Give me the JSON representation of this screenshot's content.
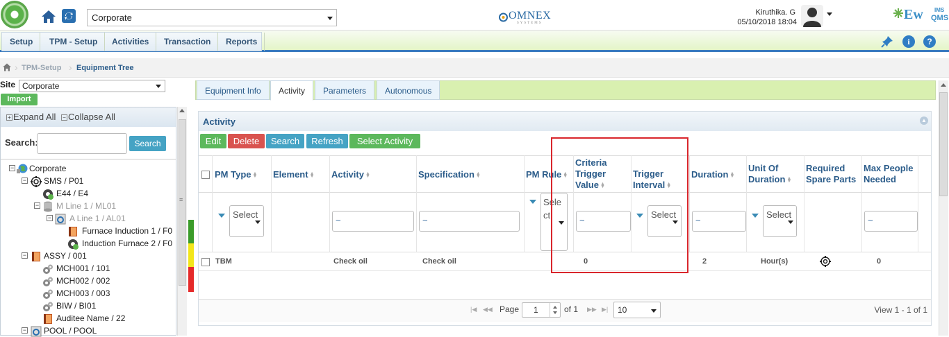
{
  "header": {
    "top_select_value": "Corporate",
    "brand_center": "OMNEX",
    "brand_center_sub": "SYSTEMS",
    "user_name": "Kiruthika. G",
    "datetime": "05/10/2018 18:04",
    "brand_right": "Ew",
    "brand_right_ims": "IMS",
    "brand_right_qms": "QMS"
  },
  "menu": {
    "items": [
      "Setup",
      "TPM - Setup",
      "Activities",
      "Transaction",
      "Reports"
    ]
  },
  "breadcrumb": {
    "items": [
      "TPM-Setup",
      "Equipment Tree"
    ]
  },
  "left_panel": {
    "site_label": "Site",
    "site_value": "Corporate",
    "import_label": "Import",
    "expand_all": "Expand All",
    "collapse_all": "Collapse All",
    "search_label": "Search:",
    "search_button": "Search",
    "tree": [
      {
        "label": "Corporate"
      },
      {
        "label": "SMS / P01"
      },
      {
        "label": "E44 / E4"
      },
      {
        "label": "M Line 1 / ML01"
      },
      {
        "label": "A Line 1 / AL01"
      },
      {
        "label": "Furnace Induction 1 / F0"
      },
      {
        "label": "Induction Furnace 2 / F0"
      },
      {
        "label": "ASSY / 001"
      },
      {
        "label": "MCH001 / 101"
      },
      {
        "label": "MCH002 / 002"
      },
      {
        "label": "MCH003 / 003"
      },
      {
        "label": "BIW / BI01"
      },
      {
        "label": "Auditee Name / 22"
      },
      {
        "label": "POOL / POOL"
      }
    ]
  },
  "tabs": [
    "Equipment Info",
    "Activity",
    "Parameters",
    "Autonomous"
  ],
  "activity": {
    "title": "Activity",
    "buttons": [
      "Edit",
      "Delete",
      "Search",
      "Refresh",
      "Select Activity"
    ],
    "columns": [
      {
        "line1": "PM Type"
      },
      {
        "line1": "Element"
      },
      {
        "line1": "Activity"
      },
      {
        "line1": "Specification"
      },
      {
        "line1": "PM Rule"
      },
      {
        "line1": "Criteria",
        "line2": "Trigger",
        "line3": "Value"
      },
      {
        "line1": "Trigger",
        "line2": "Interval"
      },
      {
        "line1": "Duration"
      },
      {
        "line1": "Unit Of",
        "line2": "Duration"
      },
      {
        "line1": "Required",
        "line2": "Spare Parts"
      },
      {
        "line1": "Max People",
        "line2": "Needed"
      }
    ],
    "filters": {
      "select_placeholder": "Select",
      "text_placeholder": "~",
      "pm_rule_select": "Select"
    },
    "rows": [
      {
        "pm_type": "TBM",
        "element": "",
        "activity": "Check oil",
        "specification": "Check oil",
        "pm_rule": "",
        "criteria_trigger_value": "0",
        "trigger_interval": "",
        "duration": "2",
        "unit_of_duration": "Hour(s)",
        "max_people": "0"
      }
    ],
    "pager": {
      "page_label": "Page",
      "page_value": "1",
      "of_label": "of 1",
      "page_size": "10",
      "view_text": "View 1 - 1 of 1"
    }
  },
  "status_colors": {
    "green": "#3a9c2a",
    "yellow": "#f3e61a",
    "red": "#e52a2a"
  },
  "highlight_color": "#d9262c"
}
